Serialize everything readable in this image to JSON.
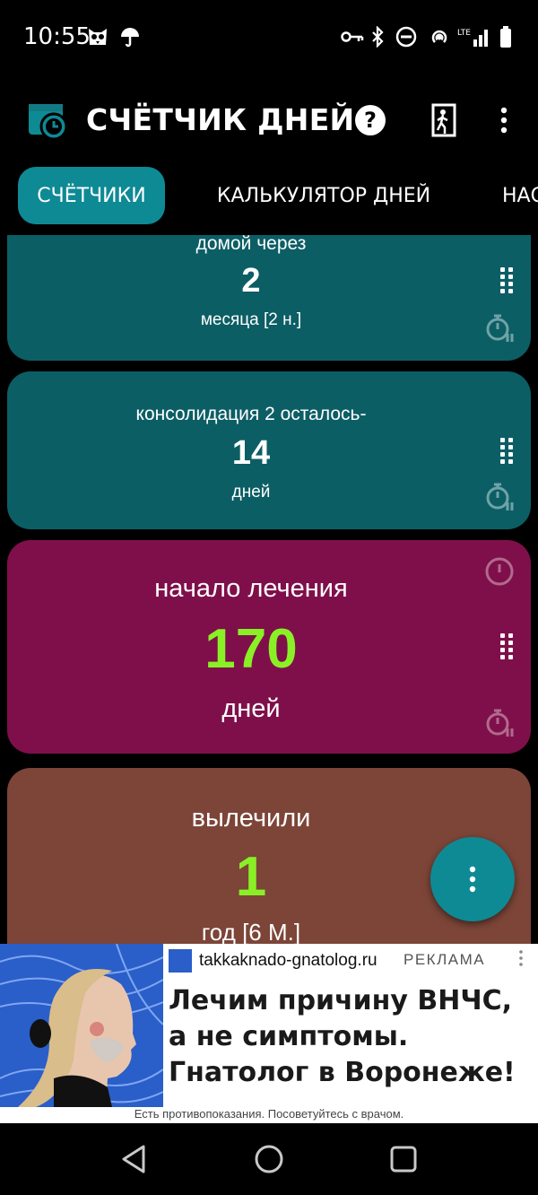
{
  "status": {
    "time": "10:55",
    "network": "LTE"
  },
  "app": {
    "title": "СЧЁТЧИК ДНЕЙ",
    "actions": [
      "help-icon",
      "exit-icon",
      "more-vert-icon"
    ]
  },
  "tabs": [
    {
      "label": "СЧЁТЧИКИ",
      "active": true
    },
    {
      "label": "КАЛЬКУЛЯТОР ДНЕЙ",
      "active": false
    },
    {
      "label": "НАС",
      "active": false
    }
  ],
  "counters": [
    {
      "title": "домой через",
      "value": "2",
      "unit": "месяца [2 н.]",
      "color": "#0c5e65",
      "value_color": "#ffffff"
    },
    {
      "title": "консолидация 2 осталось-",
      "value": "14",
      "unit": "дней",
      "color": "#0c5e65",
      "value_color": "#ffffff"
    },
    {
      "title": "начало лечения",
      "value": "170",
      "unit": "дней",
      "color": "#7f0f4a",
      "value_color": "#8af026"
    },
    {
      "title": "вылечили",
      "value": "1",
      "unit": "год [6 М.]",
      "color": "#7c4538",
      "value_color": "#8af026"
    }
  ],
  "ad": {
    "domain": "takkaknado-gnatolog.ru",
    "label": "РЕКЛАМА",
    "headline": "Лечим причину ВНЧС, а не симптомы. Гнатолог в Воронеже!",
    "disclaimer": "Есть противопоказания. Посоветуйтесь с врачом."
  },
  "colors": {
    "accent": "#0e8a95",
    "background": "#000000"
  }
}
